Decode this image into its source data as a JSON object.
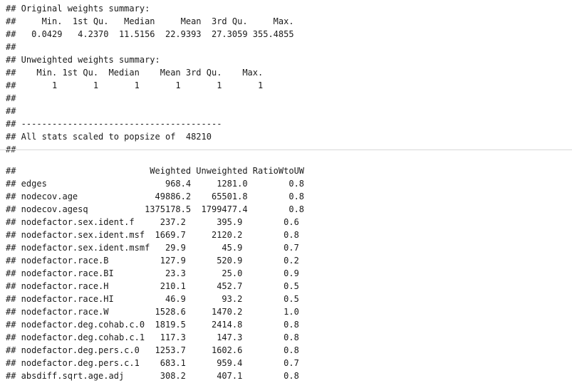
{
  "output_block_1": {
    "lines": [
      "## Original weights summary:",
      "##     Min.  1st Qu.   Median     Mean  3rd Qu.     Max. ",
      "##   0.0429   4.2370  11.5156  22.9393  27.3059 355.4855 ",
      "## ",
      "## Unweighted weights summary:",
      "##    Min. 1st Qu.  Median    Mean 3rd Qu.    Max. ",
      "##       1       1       1       1       1       1 ",
      "## ",
      "## ",
      "## ---------------------------------------",
      "## All stats scaled to popsize of  48210",
      "## ---------------------------------------"
    ]
  },
  "output_block_2": {
    "lines": [
      "##                          Weighted Unweighted RatioWtoUW",
      "## edges                       968.4     1281.0        0.8",
      "## nodecov.age               49886.2    65501.8        0.8",
      "## nodecov.agesq           1375178.5  1799477.4        0.8",
      "## nodefactor.sex.ident.f     237.2      395.9        0.6",
      "## nodefactor.sex.ident.msf  1669.7     2120.2        0.8",
      "## nodefactor.sex.ident.msmf   29.9       45.9        0.7",
      "## nodefactor.race.B          127.9      520.9        0.2",
      "## nodefactor.race.BI          23.3       25.0        0.9",
      "## nodefactor.race.H          210.1      452.7        0.5",
      "## nodefactor.race.HI          46.9       93.2        0.5",
      "## nodefactor.race.W         1528.6     1470.2        1.0",
      "## nodefactor.deg.cohab.c.0  1819.5     2414.8        0.8",
      "## nodefactor.deg.cohab.c.1   117.3      147.3        0.8",
      "## nodefactor.deg.pers.c.0   1253.7     1602.6        0.8",
      "## nodefactor.deg.pers.c.1    683.1      959.4        0.7",
      "## absdiff.sqrt.age.adj       308.2      407.1        0.8"
    ]
  }
}
